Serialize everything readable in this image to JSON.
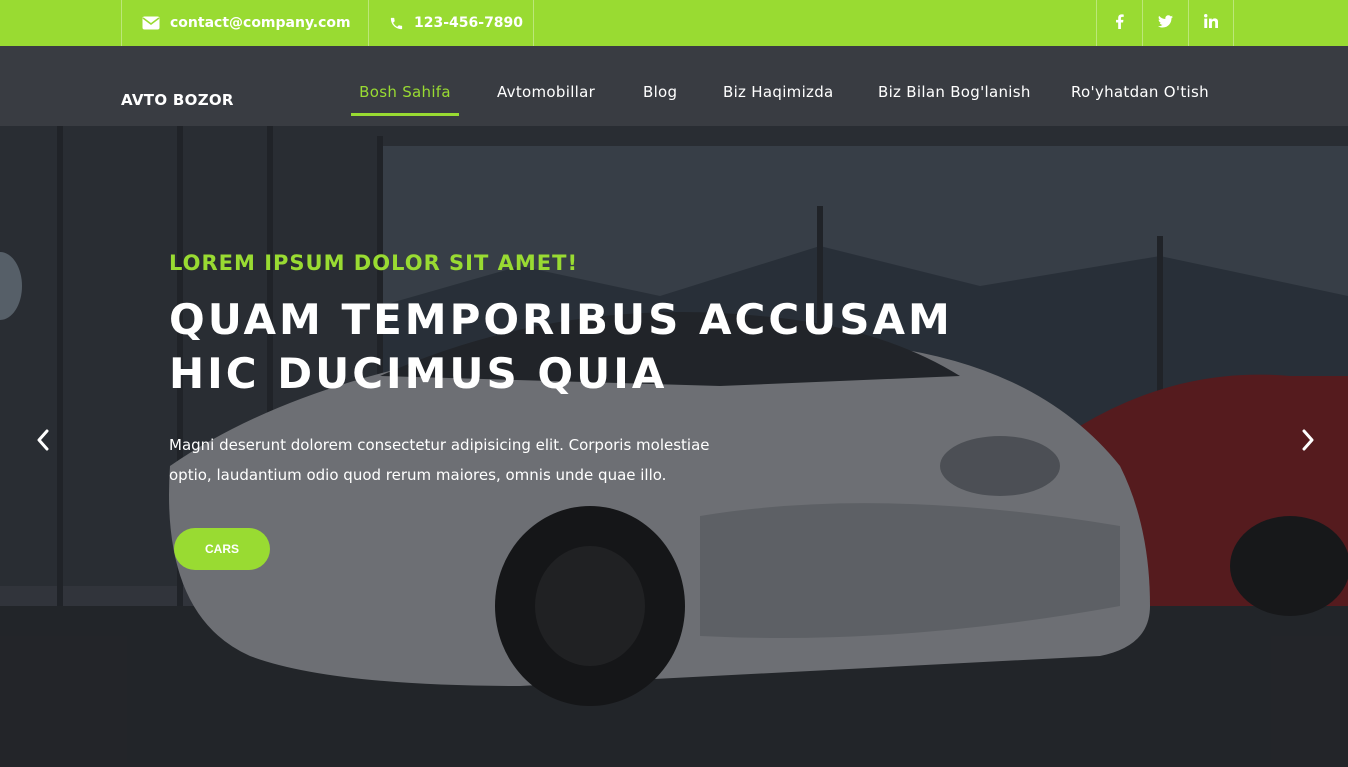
{
  "topbar": {
    "email": "contact@company.com",
    "phone": "123-456-7890",
    "social": [
      {
        "icon": "facebook-icon",
        "glyph": "f"
      },
      {
        "icon": "twitter-icon",
        "glyph": "t"
      },
      {
        "icon": "linkedin-icon",
        "glyph": "in"
      }
    ]
  },
  "header": {
    "logo": "AVTO BOZOR",
    "nav": [
      {
        "label": "Bosh Sahifa",
        "active": true
      },
      {
        "label": "Avtomobillar",
        "active": false
      },
      {
        "label": "Blog",
        "active": false
      },
      {
        "label": "Biz Haqimizda",
        "active": false
      },
      {
        "label": "Biz Bilan Bog'lanish",
        "active": false
      },
      {
        "label": "Ro'yhatdan O'tish",
        "active": false
      }
    ]
  },
  "hero": {
    "kicker": "LOREM IPSUM DOLOR SIT AMET!",
    "headline_line1": "QUAM TEMPORIBUS ACCUSAM",
    "headline_line2": "HIC DUCIMUS QUIA",
    "description_line1": "Magni deserunt dolorem consectetur adipisicing elit. Corporis molestiae",
    "description_line2": "optio, laudantium odio quod rerum maiores, omnis unde quae illo.",
    "cta_label": "CARS"
  },
  "colors": {
    "accent": "#99db32",
    "text": "#ffffff"
  }
}
